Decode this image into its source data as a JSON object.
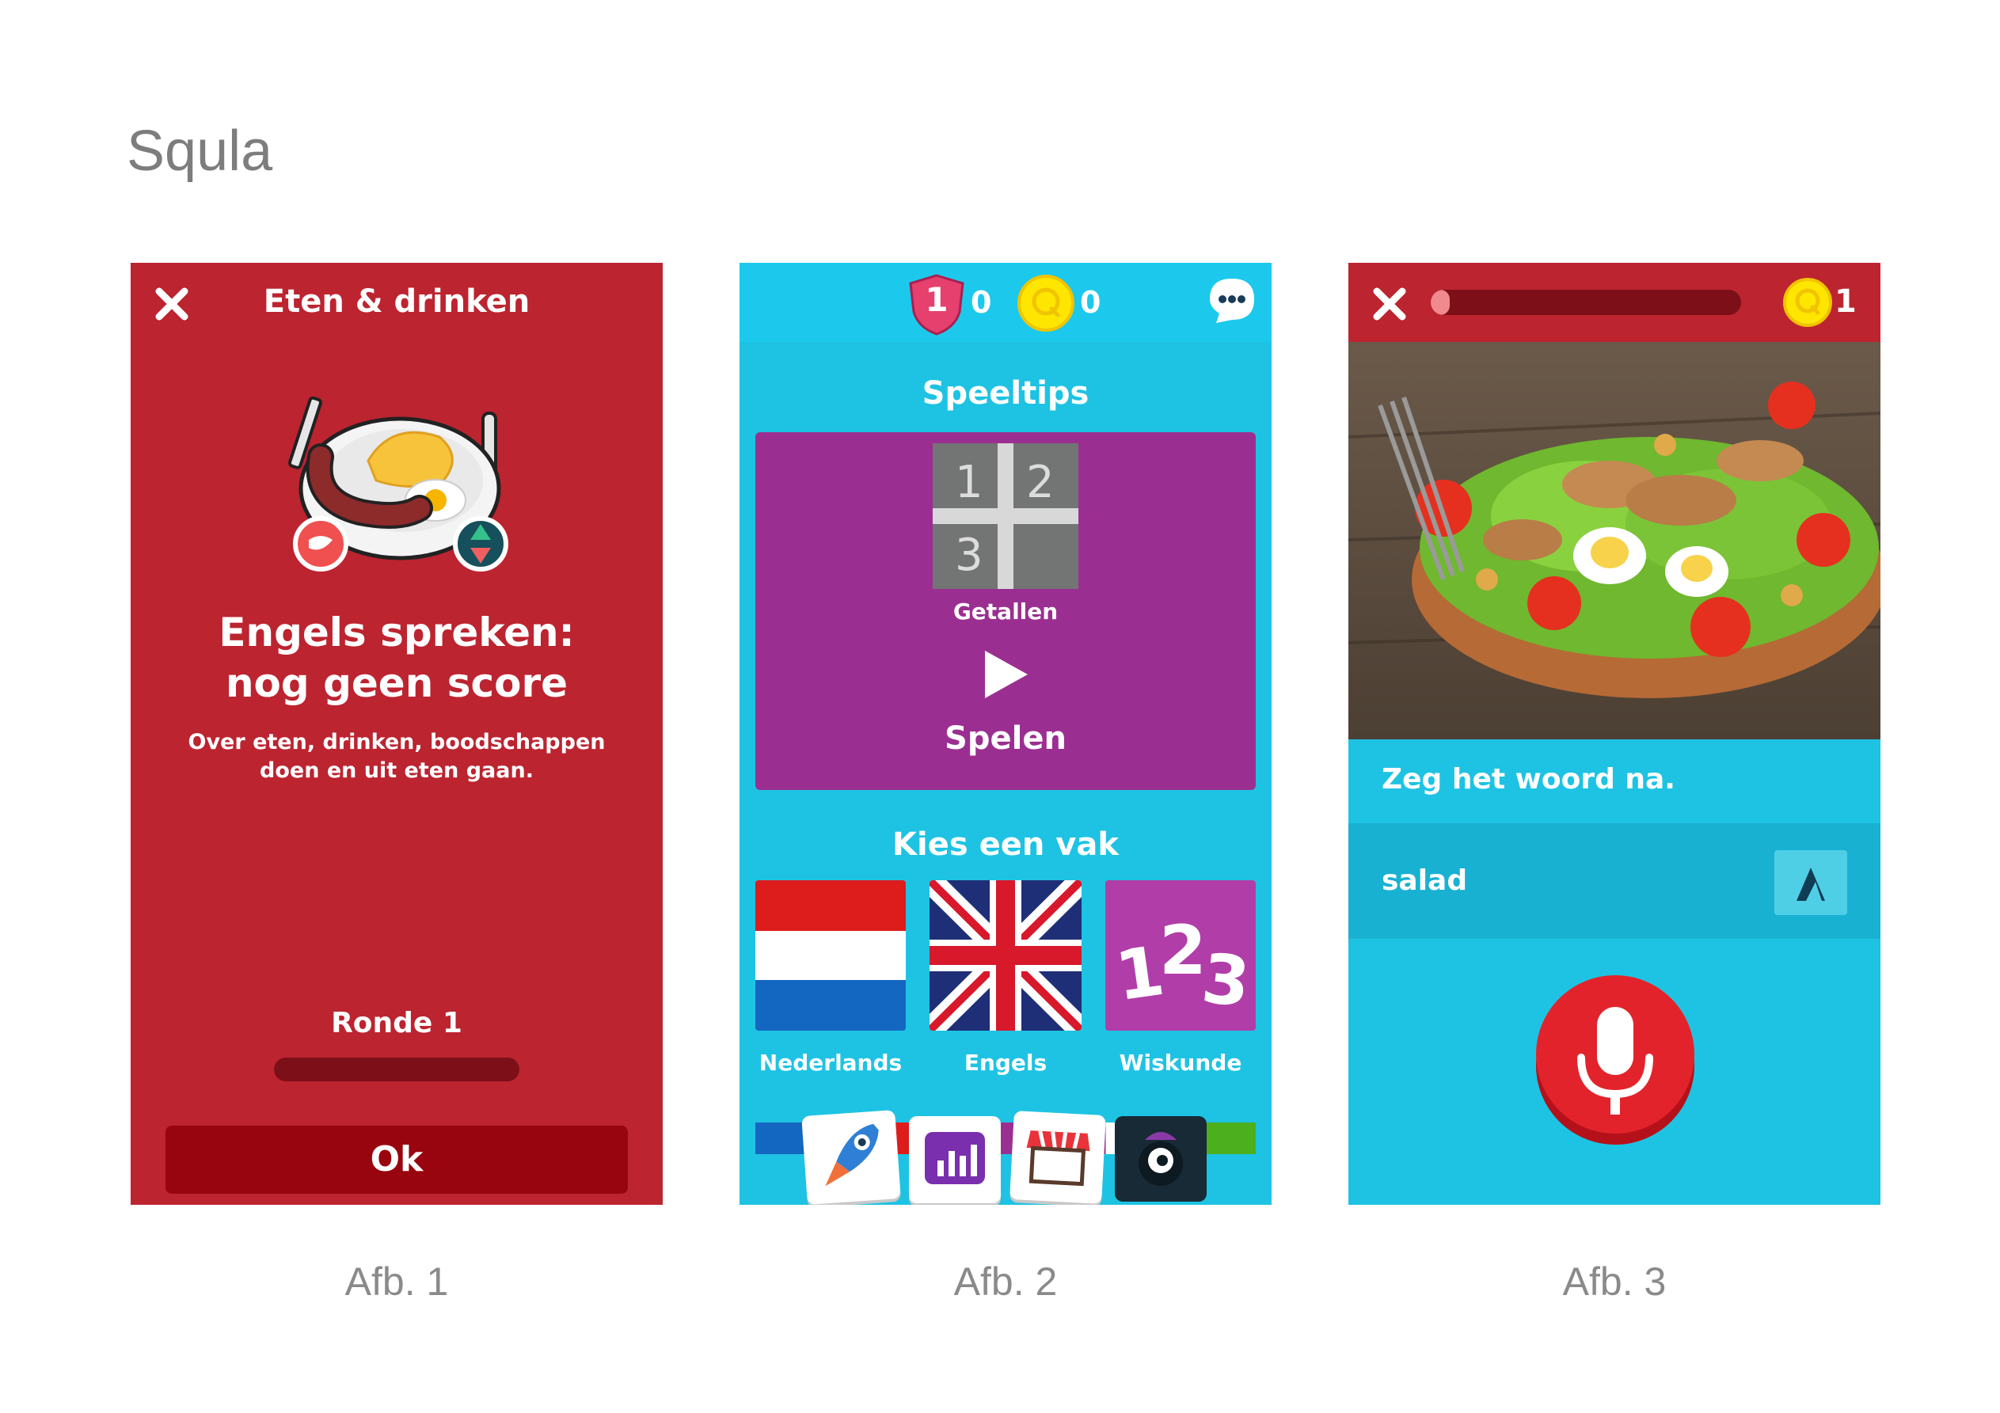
{
  "page": {
    "title": "Squla"
  },
  "captions": [
    "Afb. 1",
    "Afb. 2",
    "Afb. 3"
  ],
  "screen1": {
    "header_title": "Eten & drinken",
    "heading": "Engels spreken: nog geen score",
    "description": "Over eten, drinken, boodschappen doen en uit eten gaan.",
    "round_label": "Ronde 1",
    "round_progress": 0,
    "ok_label": "Ok",
    "colors": {
      "background": "#bc2430",
      "button": "#98050f",
      "bar": "#7d0f18"
    }
  },
  "screen2": {
    "shield_count": "1",
    "shield_score": "0",
    "coin_score": "0",
    "speeltips_title": "Speeltips",
    "tip_label": "Getallen",
    "play_label": "Spelen",
    "subjects_title": "Kies een vak",
    "subjects": [
      {
        "label": "Nederlands",
        "icon": "netherlands-flag-icon"
      },
      {
        "label": "Engels",
        "icon": "union-jack-flag-icon"
      },
      {
        "label": "Wiskunde",
        "icon": "numbers-123-icon"
      }
    ],
    "tiny_digits": [
      "1",
      "2",
      "3"
    ],
    "bottom_nav": [
      "rocket-icon",
      "stats-icon",
      "shop-icon",
      "monster-icon"
    ],
    "colors": {
      "background": "#1ec3e3",
      "card": "#9b2f91"
    }
  },
  "screen3": {
    "coin_count": "1",
    "progress": 0.05,
    "prompt": "Zeg het woord na.",
    "word": "salad",
    "colors": {
      "header": "#bc2430",
      "background": "#1ec3e3",
      "mic": "#e3232b"
    }
  }
}
